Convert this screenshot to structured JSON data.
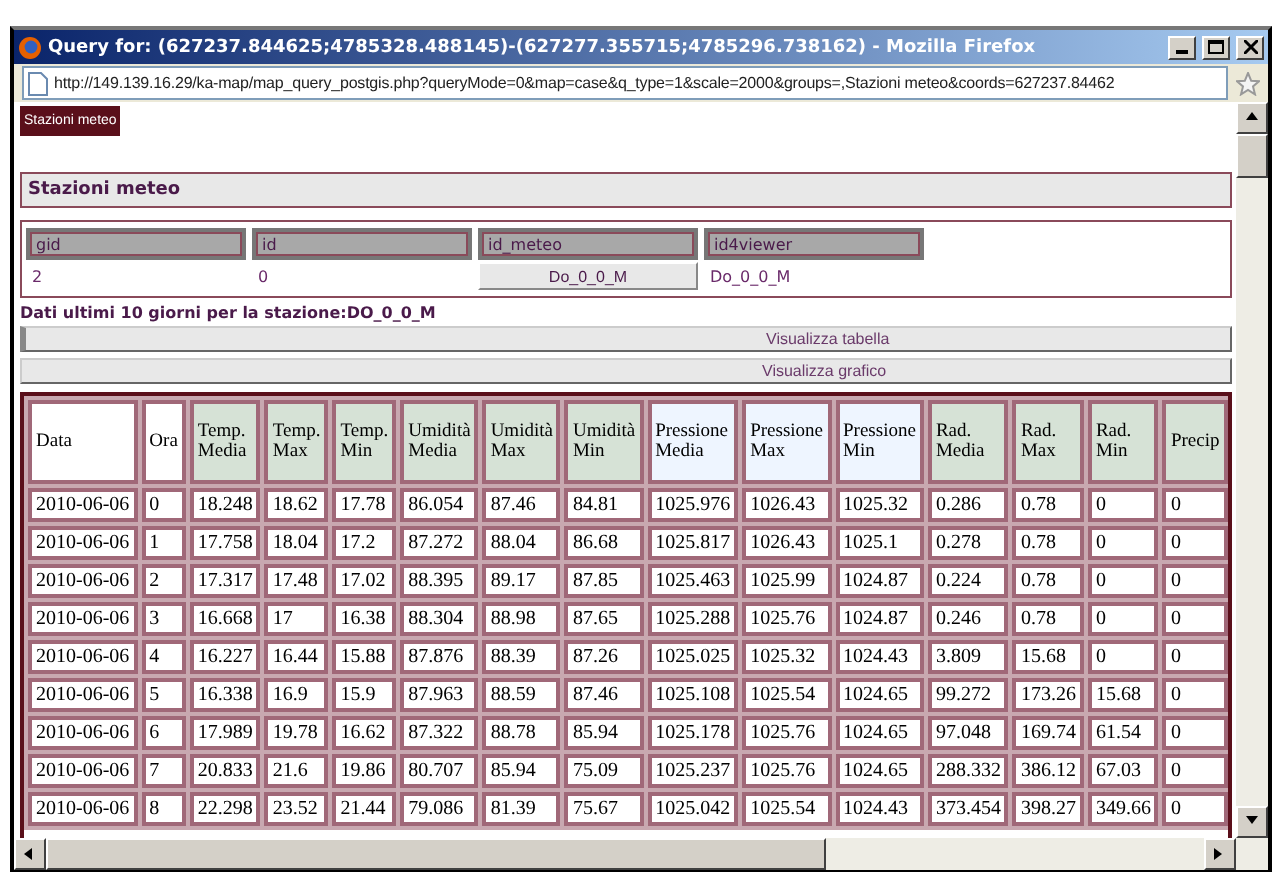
{
  "window": {
    "title": "Query for: (627237.844625;4785328.488145)-(627277.355715;4785296.738162) - Mozilla Firefox"
  },
  "address_bar": {
    "url": "http://149.139.16.29/ka-map/map_query_postgis.php?queryMode=0&map=case&q_type=1&scale=2000&groups=,Stazioni meteo&coords=627237.84462"
  },
  "layer_button": "Stazioni meteo",
  "section_title": "Stazioni meteo",
  "attributes": {
    "columns": [
      "gid",
      "id",
      "id_meteo",
      "id4viewer"
    ],
    "values": [
      {
        "kind": "text",
        "text": "2"
      },
      {
        "kind": "text",
        "text": "0"
      },
      {
        "kind": "button",
        "text": "Do_0_0_M"
      },
      {
        "kind": "text",
        "text": "Do_0_0_M"
      }
    ]
  },
  "caption": "Dati ultimi 10 giorni per la stazione:DO_0_0_M",
  "view_buttons": [
    "Visualizza tabella",
    "Visualizza grafico"
  ],
  "data_table": {
    "columns": [
      {
        "label": "Data",
        "color": "#ffffff"
      },
      {
        "label": "Ora",
        "color": "#ffffff"
      },
      {
        "label": "Temp. Media",
        "color": "#d6e2d6"
      },
      {
        "label": "Temp. Max",
        "color": "#d6e2d6"
      },
      {
        "label": "Temp. Min",
        "color": "#d6e2d6"
      },
      {
        "label": "Umidità Media",
        "color": "#d6e2d6"
      },
      {
        "label": "Umidità Max",
        "color": "#d6e2d6"
      },
      {
        "label": "Umidità Min",
        "color": "#d6e2d6"
      },
      {
        "label": "Pressione Media",
        "color": "#eef5ff"
      },
      {
        "label": "Pressione Max",
        "color": "#eef5ff"
      },
      {
        "label": "Pressione Min",
        "color": "#eef5ff"
      },
      {
        "label": "Rad. Media",
        "color": "#d6e2d6"
      },
      {
        "label": "Rad. Max",
        "color": "#d6e2d6"
      },
      {
        "label": "Rad. Min",
        "color": "#d6e2d6"
      },
      {
        "label": "Precip",
        "color": "#d6e2d6"
      }
    ],
    "rows": [
      [
        "2010-06-06",
        "0",
        "18.248",
        "18.62",
        "17.78",
        "86.054",
        "87.46",
        "84.81",
        "1025.976",
        "1026.43",
        "1025.32",
        "0.286",
        "0.78",
        "0",
        "0"
      ],
      [
        "2010-06-06",
        "1",
        "17.758",
        "18.04",
        "17.2",
        "87.272",
        "88.04",
        "86.68",
        "1025.817",
        "1026.43",
        "1025.1",
        "0.278",
        "0.78",
        "0",
        "0"
      ],
      [
        "2010-06-06",
        "2",
        "17.317",
        "17.48",
        "17.02",
        "88.395",
        "89.17",
        "87.85",
        "1025.463",
        "1025.99",
        "1024.87",
        "0.224",
        "0.78",
        "0",
        "0"
      ],
      [
        "2010-06-06",
        "3",
        "16.668",
        "17",
        "16.38",
        "88.304",
        "88.98",
        "87.65",
        "1025.288",
        "1025.76",
        "1024.87",
        "0.246",
        "0.78",
        "0",
        "0"
      ],
      [
        "2010-06-06",
        "4",
        "16.227",
        "16.44",
        "15.88",
        "87.876",
        "88.39",
        "87.26",
        "1025.025",
        "1025.32",
        "1024.43",
        "3.809",
        "15.68",
        "0",
        "0"
      ],
      [
        "2010-06-06",
        "5",
        "16.338",
        "16.9",
        "15.9",
        "87.963",
        "88.59",
        "87.46",
        "1025.108",
        "1025.54",
        "1024.65",
        "99.272",
        "173.26",
        "15.68",
        "0"
      ],
      [
        "2010-06-06",
        "6",
        "17.989",
        "19.78",
        "16.62",
        "87.322",
        "88.78",
        "85.94",
        "1025.178",
        "1025.76",
        "1024.65",
        "97.048",
        "169.74",
        "61.54",
        "0"
      ],
      [
        "2010-06-06",
        "7",
        "20.833",
        "21.6",
        "19.86",
        "80.707",
        "85.94",
        "75.09",
        "1025.237",
        "1025.76",
        "1024.65",
        "288.332",
        "386.12",
        "67.03",
        "0"
      ],
      [
        "2010-06-06",
        "8",
        "22.298",
        "23.52",
        "21.44",
        "79.086",
        "81.39",
        "75.67",
        "1025.042",
        "1025.54",
        "1024.43",
        "373.454",
        "398.27",
        "349.66",
        "0"
      ]
    ]
  }
}
